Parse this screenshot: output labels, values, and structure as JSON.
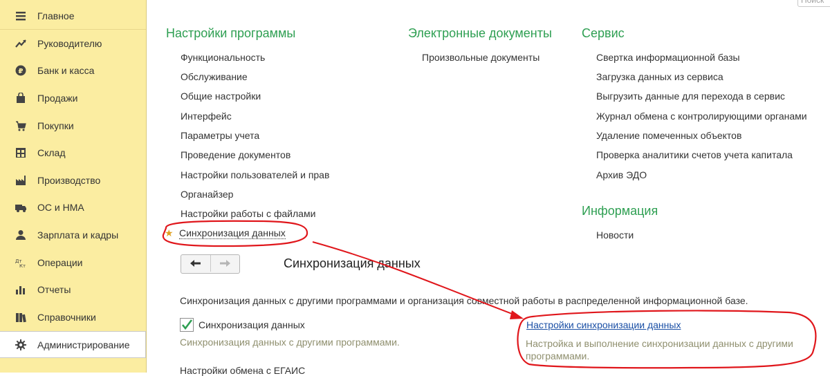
{
  "sidebar": {
    "items": [
      {
        "label": "Главное",
        "icon": "menu-lines-icon"
      },
      {
        "label": "Руководителю",
        "icon": "trend-up-icon"
      },
      {
        "label": "Банк и касса",
        "icon": "ruble-coin-icon"
      },
      {
        "label": "Продажи",
        "icon": "shopping-bag-icon"
      },
      {
        "label": "Покупки",
        "icon": "cart-icon"
      },
      {
        "label": "Склад",
        "icon": "warehouse-icon"
      },
      {
        "label": "Производство",
        "icon": "factory-icon"
      },
      {
        "label": "ОС и НМА",
        "icon": "truck-icon"
      },
      {
        "label": "Зарплата и кадры",
        "icon": "person-icon"
      },
      {
        "label": "Операции",
        "icon": "debit-credit-icon"
      },
      {
        "label": "Отчеты",
        "icon": "bar-chart-icon"
      },
      {
        "label": "Справочники",
        "icon": "books-icon"
      },
      {
        "label": "Администрирование",
        "icon": "gear-icon"
      }
    ],
    "active_index": 12,
    "background": "#fbeda1"
  },
  "search": {
    "placeholder": "Поиск"
  },
  "sections": {
    "settings": {
      "title": "Настройки программы",
      "links": [
        "Функциональность",
        "Обслуживание",
        "Общие настройки",
        "Интерфейс",
        "Параметры учета",
        "Проведение документов",
        "Настройки пользователей и прав",
        "Органайзер",
        "Настройки работы с файлами",
        "Синхронизация данных"
      ]
    },
    "edocs": {
      "title": "Электронные документы",
      "links": [
        "Произвольные документы"
      ]
    },
    "service": {
      "title": "Сервис",
      "links": [
        "Свертка информационной базы",
        "Загрузка данных из сервиса",
        "Выгрузить данные для перехода в сервис",
        "Журнал обмена с контролирующими органами",
        "Удаление помеченных объектов",
        "Проверка аналитики счетов учета капитала",
        "Архив ЭДО"
      ]
    },
    "info": {
      "title": "Информация",
      "links": [
        "Новости"
      ]
    }
  },
  "panel": {
    "title": "Синхронизация данных",
    "description": "Синхронизация данных с другими программами и организация совместной работы в распределенной информационной базе.",
    "checkbox_label": "Синхронизация данных",
    "checkbox_checked": true,
    "checkbox_hint": "Синхронизация данных с другими программами.",
    "sync_settings_link": "Настройки синхронизации данных",
    "sync_settings_hint": "Настройка и выполнение синхронизации данных с другими программами.",
    "cut_text": "Настройки обмена с ЕГАИС"
  },
  "colors": {
    "accent_green": "#2e9f52",
    "annotation_red": "#e0161b",
    "link_blue": "#1a4fa5"
  }
}
